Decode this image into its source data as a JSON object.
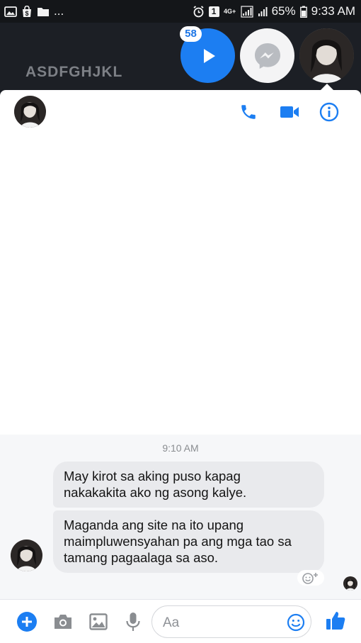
{
  "status_bar": {
    "ellipsis": "...",
    "notification_badge": "1",
    "network_label": "4G+",
    "battery": "65%",
    "time": "9:33 AM"
  },
  "overlay": {
    "caption": "ASDFGHJKL",
    "chat_heads": {
      "play_badge": "58"
    }
  },
  "conversation": {
    "header": {
      "icons": [
        "phone-icon",
        "video-camera-icon",
        "info-icon"
      ]
    },
    "timestamp": "9:10 AM",
    "messages": [
      {
        "text_line1": "May kirot sa aking puso kapag",
        "text_line2": "nakakakita ako ng asong kalye."
      },
      {
        "text_line1": "Maganda ang site na ito upang",
        "text_line2": "maimpluwensyahan pa ang mga tao sa",
        "text_line3": "tamang pagaalaga sa aso."
      }
    ]
  },
  "composer": {
    "placeholder": "Aa",
    "icons": [
      "plus-icon",
      "camera-icon",
      "image-icon",
      "microphone-icon",
      "emoji-icon",
      "thumbs-up-icon"
    ]
  },
  "colors": {
    "accent": "#1c7ef2",
    "bubble": "#e9eaed",
    "chat_background": "#f6f7f9",
    "status_bar": "#141619"
  }
}
